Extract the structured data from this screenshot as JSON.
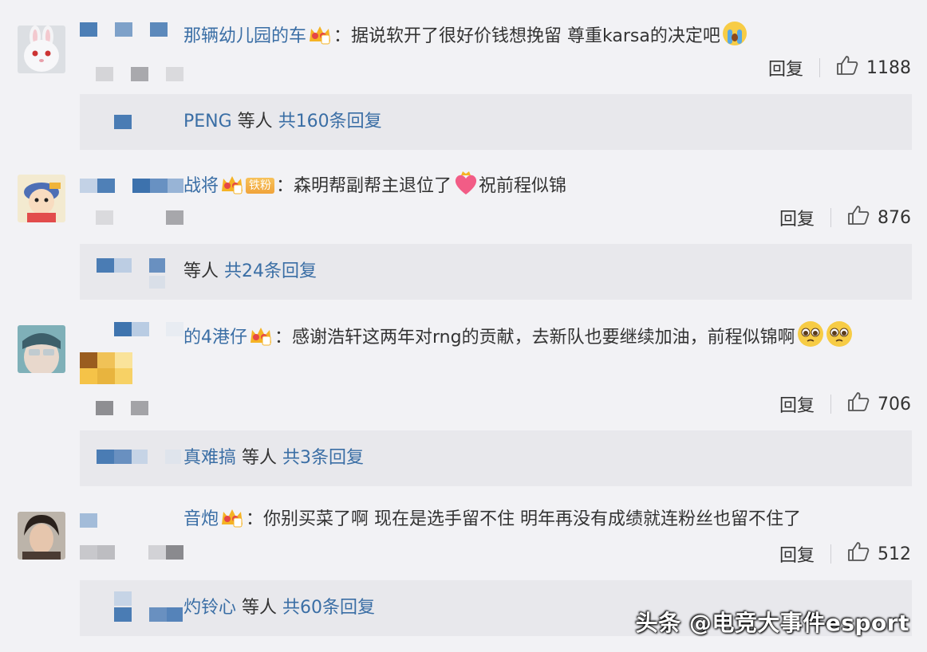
{
  "colors": {
    "name": "#3a6ea5",
    "text": "#333333",
    "background": "#f2f2f5",
    "reply_bar": "#e8e8ec"
  },
  "icons": {
    "crown": "vip-crown-icon",
    "like": "thumbs-up-icon"
  },
  "labels": {
    "reply": "回复"
  },
  "comments": [
    {
      "name": "那辆幼儿园的车",
      "crown_level": "1",
      "fan_badge": "",
      "text": "据说软开了很好价钱想挽留 尊重karsa的决定吧",
      "emoji": "crying-face",
      "likes": "1188",
      "reply_summary": {
        "names": "PENG",
        "middle": "等人",
        "total": "共160条回复"
      }
    },
    {
      "name": "战将",
      "crown_level": "3",
      "fan_badge": "铁粉",
      "text": "森明帮副帮主退位了",
      "text_after": "祝前程似锦",
      "emoji": "crowned-heart",
      "likes": "876",
      "reply_summary": {
        "names": "",
        "middle": "等人",
        "total": "共24条回复"
      }
    },
    {
      "name": "的4港仔",
      "crown_level": "3",
      "fan_badge": "",
      "text": "感谢浩轩这两年对rng的贡献，去新队也要继续加油，前程似锦啊",
      "emoji": "pleading-face",
      "likes": "706",
      "reply_summary": {
        "names": "真难搞",
        "middle": "等人",
        "total": "共3条回复"
      }
    },
    {
      "name": "音炮",
      "crown_level": "5",
      "fan_badge": "",
      "text": "你别买菜了啊 现在是选手留不住 明年再没有成绩就连粉丝也留不住了",
      "emoji": "",
      "likes": "512",
      "reply_summary": {
        "names": "灼铃心",
        "middle": "等人",
        "total": "共60条回复"
      }
    }
  ],
  "watermark": "头条 @电竞大事件esport"
}
